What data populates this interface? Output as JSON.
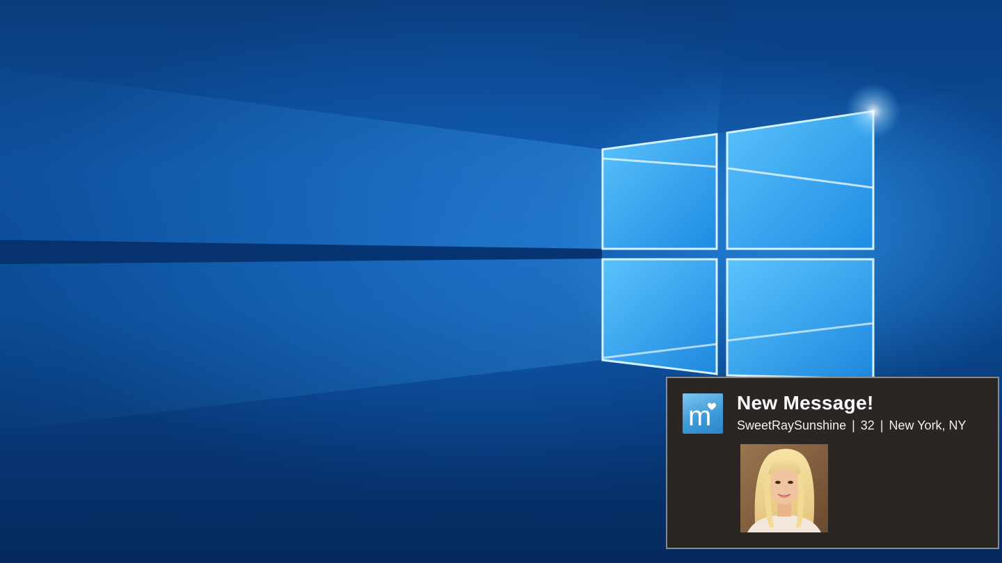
{
  "desktop": {
    "wallpaper": "windows-10-hero-wallpaper",
    "colors": {
      "background_dark": "#05295c",
      "background_mid": "#0d4f9c",
      "window_glow": "#5fc3ff"
    }
  },
  "notification": {
    "app_icon": "match-app-icon",
    "title": "New Message!",
    "sender": {
      "username": "SweetRaySunshine",
      "age": "32",
      "location": "New York, NY"
    },
    "separator": "|",
    "photo": "sender-profile-photo",
    "colors": {
      "background": "#2b2523",
      "border": "#8a8a8a",
      "icon_bg": "#3f9bd8",
      "text": "#ffffff"
    }
  }
}
